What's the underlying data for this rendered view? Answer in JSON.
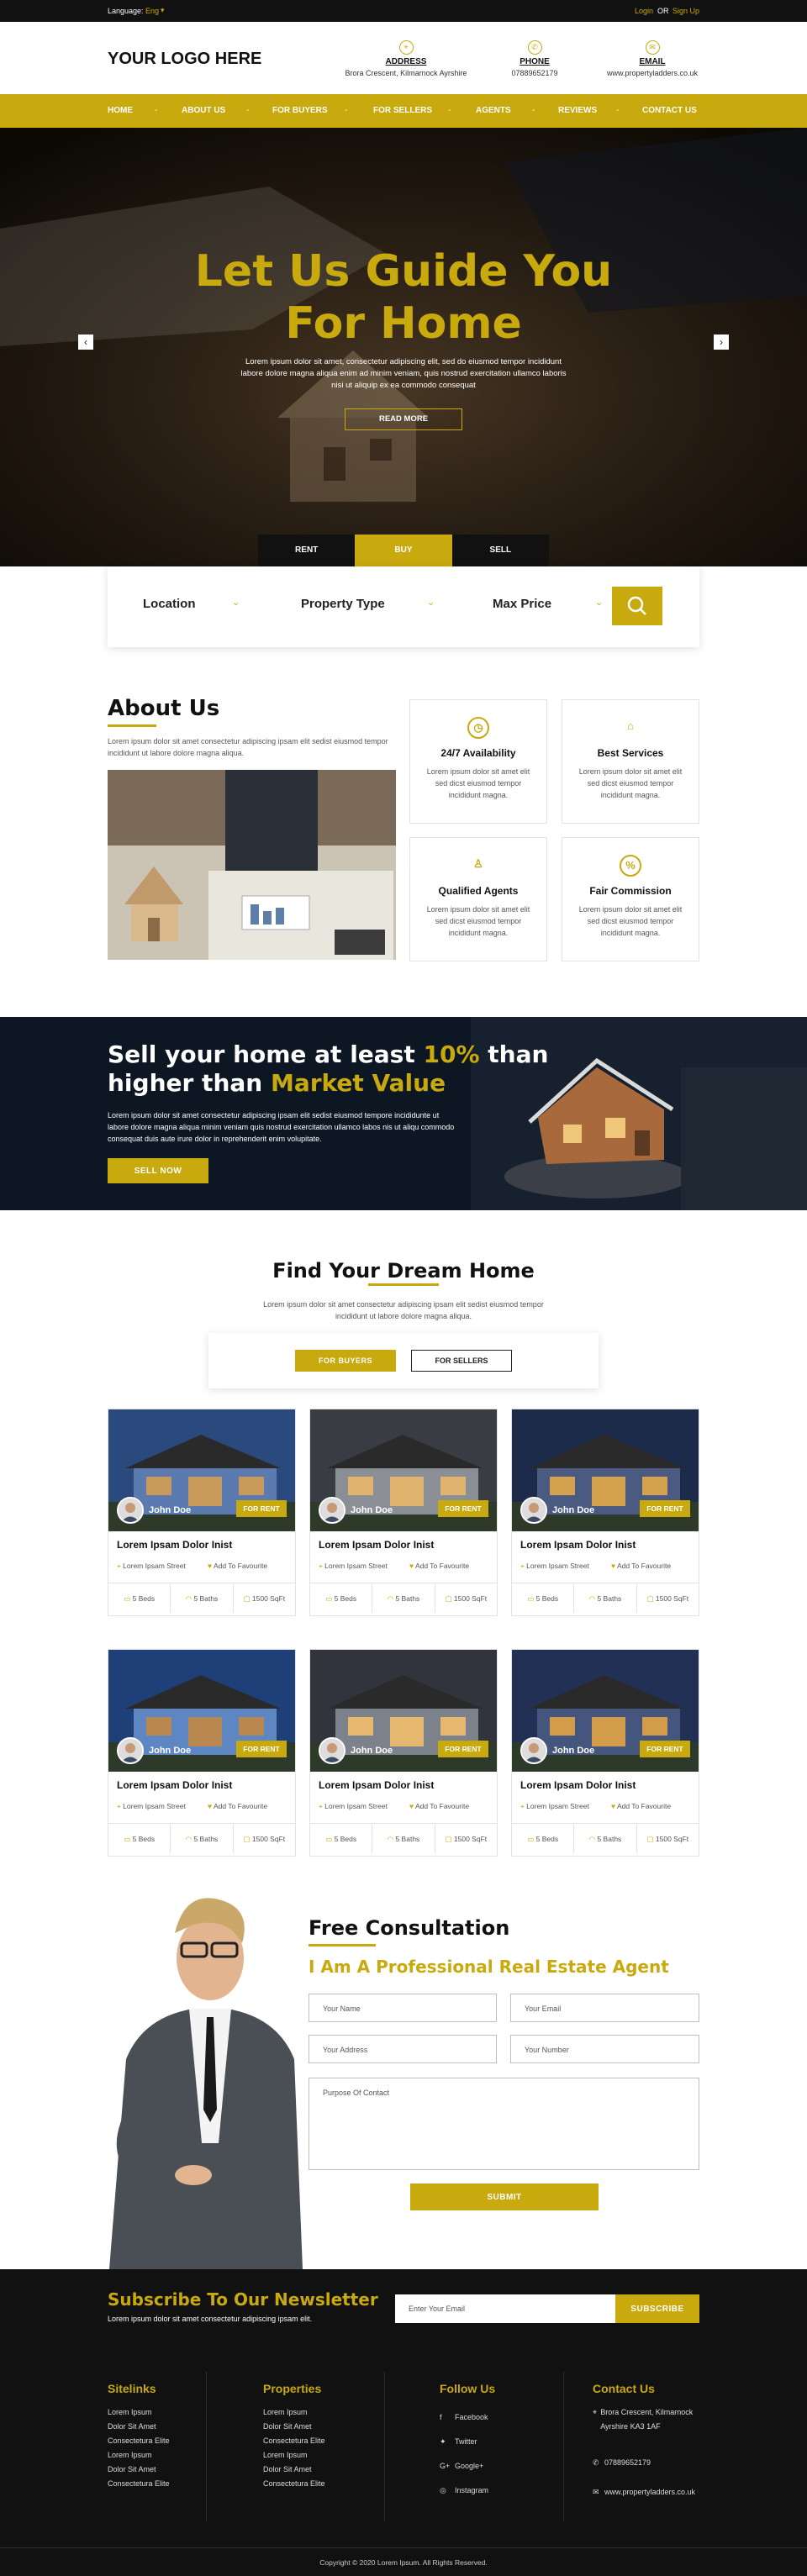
{
  "topbar": {
    "language_label": "Language:",
    "language_value": "Eng",
    "login": "Login",
    "or": "OR",
    "signup": "Sign Up"
  },
  "header": {
    "logo": "YOUR LOGO HERE",
    "address": {
      "title": "ADDRESS",
      "value": "Brora Crescent, Kilmarnock Ayrshire"
    },
    "phone": {
      "title": "PHONE",
      "value": "07889652179"
    },
    "email": {
      "title": "EMAIL",
      "value": "www.propertyladders.co.uk"
    }
  },
  "nav": [
    "HOME",
    "ABOUT US",
    "FOR BUYERS",
    "FOR SELLERS",
    "AGENTS",
    "REVIEWS",
    "CONTACT US"
  ],
  "hero": {
    "title_line1": "Let Us Guide You",
    "title_line2": "For Home",
    "text": "Lorem ipsum dolor sit amet, consectetur adipiscing elit, sed do eiusmod tempor incididunt labore dolore magna aliqua enim ad minim veniam, quis nostrud exercitation ullamco laboris nisi ut aliquip ex ea commodo consequat",
    "button": "READ MORE"
  },
  "search": {
    "tabs": [
      "RENT",
      "BUY",
      "SELL"
    ],
    "fields": [
      "Location",
      "Property Type",
      "Max Price"
    ]
  },
  "about": {
    "title": "About Us",
    "text": "Lorem ipsum dolor sit amet consectetur adipiscing ipsam elit sedist eiusmod tempor incididunt ut labore dolore magna aliqua.",
    "cards": [
      {
        "title": "24/7 Availability",
        "text": "Lorem ipsum dolor sit amet elit sed dicst eiusmod tempor incididunt magna."
      },
      {
        "title": "Best Services",
        "text": "Lorem ipsum dolor sit amet elit sed dicst eiusmod tempor incididunt magna."
      },
      {
        "title": "Qualified Agents",
        "text": "Lorem ipsum dolor sit amet elit sed dicst eiusmod tempor incididunt magna."
      },
      {
        "title": "Fair Commission",
        "text": "Lorem ipsum dolor sit amet elit sed dicst eiusmod tempor incididunt magna."
      }
    ]
  },
  "sell": {
    "line1_a": "Sell your home at least ",
    "line1_b": "10%",
    "line1_c": " than",
    "line2_a": "higher than ",
    "line2_b": "Market Value",
    "text": "Lorem ipsum dolor sit amet consectetur adipiscing ipsam elit sedist eiusmod tempore incididunte ut labore dolore magna aliqua minim veniam quis nostrud exercitation ullamco labos nis ut aliqu commodo consequat duis aute irure dolor in reprehenderit enim volupitate.",
    "button": "SELL NOW"
  },
  "find": {
    "title": "Find Your Dream Home",
    "text": "Lorem ipsum dolor sit amet consectetur adipiscing ipsam elit sedist eiusmod tempor incididunt ut labore dolore magna aliqua.",
    "tabs": [
      "FOR BUYERS",
      "FOR SELLERS"
    ],
    "properties": [
      {
        "agent": "John Doe",
        "badge": "FOR RENT",
        "title": "Lorem Ipsam Dolor Inist",
        "street": "Lorem Ipsam Street",
        "fav": "Add To Favourite",
        "beds": "5 Beds",
        "baths": "5 Baths",
        "area": "1500 SqFt"
      },
      {
        "agent": "John Doe",
        "badge": "FOR RENT",
        "title": "Lorem Ipsam Dolor Inist",
        "street": "Lorem Ipsam Street",
        "fav": "Add To Favourite",
        "beds": "5 Beds",
        "baths": "5 Baths",
        "area": "1500 SqFt"
      },
      {
        "agent": "John Doe",
        "badge": "FOR RENT",
        "title": "Lorem Ipsam Dolor Inist",
        "street": "Lorem Ipsam Street",
        "fav": "Add To Favourite",
        "beds": "5 Beds",
        "baths": "5 Baths",
        "area": "1500 SqFt"
      },
      {
        "agent": "John Doe",
        "badge": "FOR RENT",
        "title": "Lorem Ipsam Dolor Inist",
        "street": "Lorem Ipsam Street",
        "fav": "Add To Favourite",
        "beds": "5 Beds",
        "baths": "5 Baths",
        "area": "1500 SqFt"
      },
      {
        "agent": "John Doe",
        "badge": "FOR RENT",
        "title": "Lorem Ipsam Dolor Inist",
        "street": "Lorem Ipsam Street",
        "fav": "Add To Favourite",
        "beds": "5 Beds",
        "baths": "5 Baths",
        "area": "1500 SqFt"
      },
      {
        "agent": "John Doe",
        "badge": "FOR RENT",
        "title": "Lorem Ipsam Dolor Inist",
        "street": "Lorem Ipsam Street",
        "fav": "Add To Favourite",
        "beds": "5 Beds",
        "baths": "5 Baths",
        "area": "1500 SqFt"
      }
    ]
  },
  "consult": {
    "title": "Free Consultation",
    "subtitle": "I Am A Professional Real Estate Agent",
    "name": "Your Name",
    "email": "Your Email",
    "address": "Your Address",
    "number": "Your Number",
    "purpose": "Purpose Of Contact",
    "button": "SUBMIT"
  },
  "newsletter": {
    "title": "Subscribe To Our Newsletter",
    "text": "Lorem ipsum dolor sit amet consectetur adipiscing ipsam elit.",
    "placeholder": "Enter Your Email",
    "button": "SUBSCRIBE"
  },
  "footer": {
    "sitelinks": {
      "title": "Sitelinks",
      "items": [
        "Lorem Ipsum",
        "Dolor Sit Amet",
        "Consectetura Elite",
        "Lorem Ipsum",
        "Dolor Sit Amet",
        "Consectetura Elite"
      ]
    },
    "properties": {
      "title": "Properties",
      "items": [
        "Lorem Ipsum",
        "Dolor Sit Amet",
        "Consectetura Elite",
        "Lorem Ipsum",
        "Dolor Sit Amet",
        "Consectetura Elite"
      ]
    },
    "follow": {
      "title": "Follow Us",
      "items": [
        "Facebook",
        "Twitter",
        "Google+",
        "Instagram"
      ]
    },
    "contact": {
      "title": "Contact Us",
      "address": "Brora Crescent, Kilmarnock Ayrshire KA3 1AF",
      "phone": "07889652179",
      "web": "www.propertyladders.co.uk"
    },
    "copyright": "Copyright © 2020 Lorem Ipsum. All Rights Reserved."
  },
  "colors": {
    "accent": "#c8a90e",
    "dark": "#111111"
  }
}
